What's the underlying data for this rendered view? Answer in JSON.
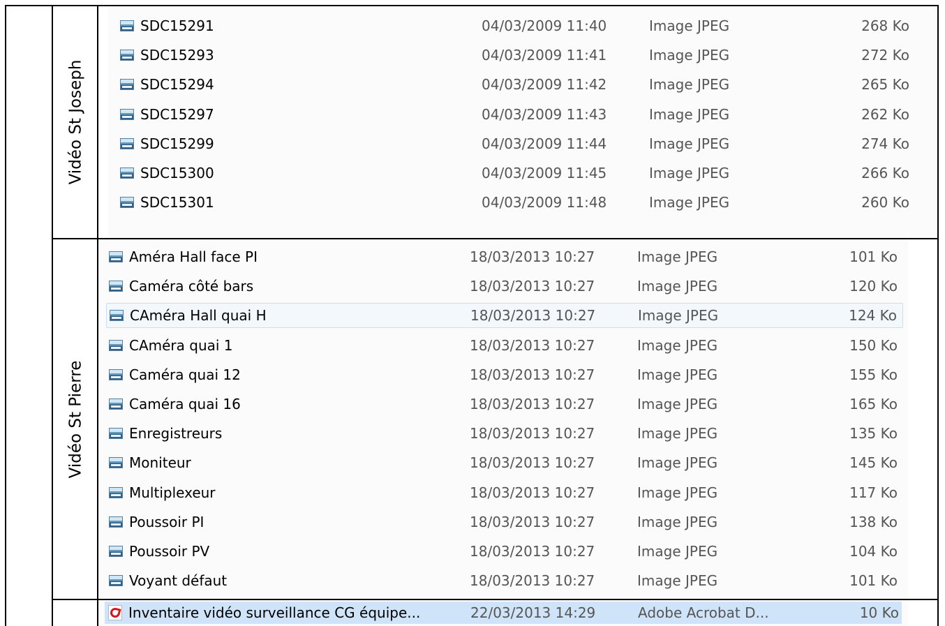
{
  "sections": [
    {
      "label": "Vidéo St Joseph",
      "files": [
        {
          "name": "SDC15291",
          "date": "04/03/2009 11:40",
          "type": "Image JPEG",
          "size": "268 Ko",
          "icon": "image-file-icon"
        },
        {
          "name": "SDC15293",
          "date": "04/03/2009 11:41",
          "type": "Image JPEG",
          "size": "272 Ko",
          "icon": "image-file-icon"
        },
        {
          "name": "SDC15294",
          "date": "04/03/2009 11:42",
          "type": "Image JPEG",
          "size": "265 Ko",
          "icon": "image-file-icon"
        },
        {
          "name": "SDC15297",
          "date": "04/03/2009 11:43",
          "type": "Image JPEG",
          "size": "262 Ko",
          "icon": "image-file-icon"
        },
        {
          "name": "SDC15299",
          "date": "04/03/2009 11:44",
          "type": "Image JPEG",
          "size": "274 Ko",
          "icon": "image-file-icon"
        },
        {
          "name": "SDC15300",
          "date": "04/03/2009 11:45",
          "type": "Image JPEG",
          "size": "266 Ko",
          "icon": "image-file-icon"
        },
        {
          "name": "SDC15301",
          "date": "04/03/2009 11:48",
          "type": "Image JPEG",
          "size": "260 Ko",
          "icon": "image-file-icon"
        }
      ]
    },
    {
      "label": "Vidéo St Pierre",
      "files": [
        {
          "name": "Améra Hall face PI",
          "date": "18/03/2013 10:27",
          "type": "Image JPEG",
          "size": "101 Ko",
          "icon": "image-file-icon"
        },
        {
          "name": "Caméra côté bars",
          "date": "18/03/2013 10:27",
          "type": "Image JPEG",
          "size": "120 Ko",
          "icon": "image-file-icon"
        },
        {
          "name": "CAméra Hall quai H",
          "date": "18/03/2013 10:27",
          "type": "Image JPEG",
          "size": "124 Ko",
          "icon": "image-file-icon",
          "state": "hover"
        },
        {
          "name": "CAméra quai 1",
          "date": "18/03/2013 10:27",
          "type": "Image JPEG",
          "size": "150 Ko",
          "icon": "image-file-icon"
        },
        {
          "name": "Caméra quai 12",
          "date": "18/03/2013 10:27",
          "type": "Image JPEG",
          "size": "155 Ko",
          "icon": "image-file-icon"
        },
        {
          "name": "Caméra quai 16",
          "date": "18/03/2013 10:27",
          "type": "Image JPEG",
          "size": "165 Ko",
          "icon": "image-file-icon"
        },
        {
          "name": "Enregistreurs",
          "date": "18/03/2013 10:27",
          "type": "Image JPEG",
          "size": "135 Ko",
          "icon": "image-file-icon"
        },
        {
          "name": "Moniteur",
          "date": "18/03/2013 10:27",
          "type": "Image JPEG",
          "size": "145 Ko",
          "icon": "image-file-icon"
        },
        {
          "name": "Multiplexeur",
          "date": "18/03/2013 10:27",
          "type": "Image JPEG",
          "size": "117 Ko",
          "icon": "image-file-icon"
        },
        {
          "name": "Poussoir PI",
          "date": "18/03/2013 10:27",
          "type": "Image JPEG",
          "size": "138 Ko",
          "icon": "image-file-icon"
        },
        {
          "name": "Poussoir PV",
          "date": "18/03/2013 10:27",
          "type": "Image JPEG",
          "size": "104 Ko",
          "icon": "image-file-icon"
        },
        {
          "name": "Voyant défaut",
          "date": "18/03/2013 10:27",
          "type": "Image JPEG",
          "size": "101 Ko",
          "icon": "image-file-icon"
        }
      ]
    },
    {
      "label": "",
      "files": [
        {
          "name": "Inventaire vidéo surveillance CG équipe...",
          "date": "22/03/2013 14:29",
          "type": "Adobe Acrobat D...",
          "size": "10 Ko",
          "icon": "pdf-file-icon",
          "state": "selected"
        }
      ]
    }
  ],
  "colors": {
    "selected": "#cfe4f8",
    "hover_border": "#c7def4",
    "pdf_red": "#d3161a"
  }
}
